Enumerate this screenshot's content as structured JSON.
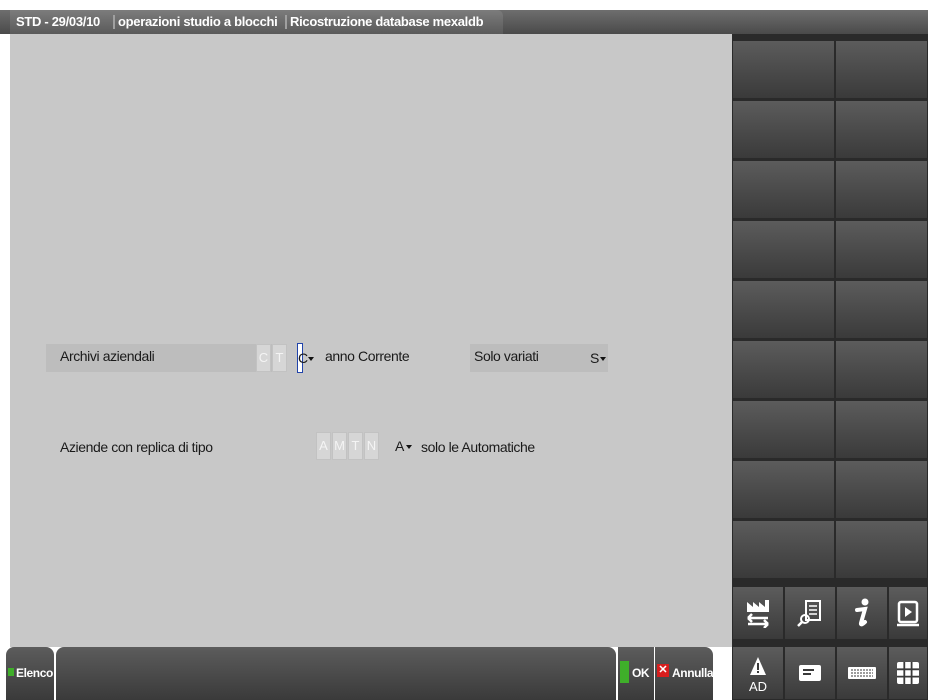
{
  "title_bar": {
    "context": "STD - 29/03/10",
    "module": "operazioni studio a blocchi",
    "function": "Ricostruzione database mexaldb"
  },
  "form": {
    "archivi": {
      "label": "Archivi aziendali",
      "options": [
        "C",
        "T"
      ],
      "value": "C",
      "description": "anno Corrente"
    },
    "solo_variati": {
      "label": "Solo variati",
      "value": "S"
    },
    "aziende_replica": {
      "label": "Aziende con replica di tipo",
      "options": [
        "A",
        "M",
        "T",
        "N"
      ],
      "value": "A",
      "description": "solo le Automatiche"
    }
  },
  "bottom_bar": {
    "elenco_label": "Elenco",
    "ok_label": "OK",
    "annulla_label": "Annulla"
  },
  "toolbar": {
    "ad_label": "AD"
  },
  "colors": {
    "accent_green": "#3fae2a",
    "cancel_red": "#d81e1e",
    "focus_blue": "#2244aa"
  }
}
